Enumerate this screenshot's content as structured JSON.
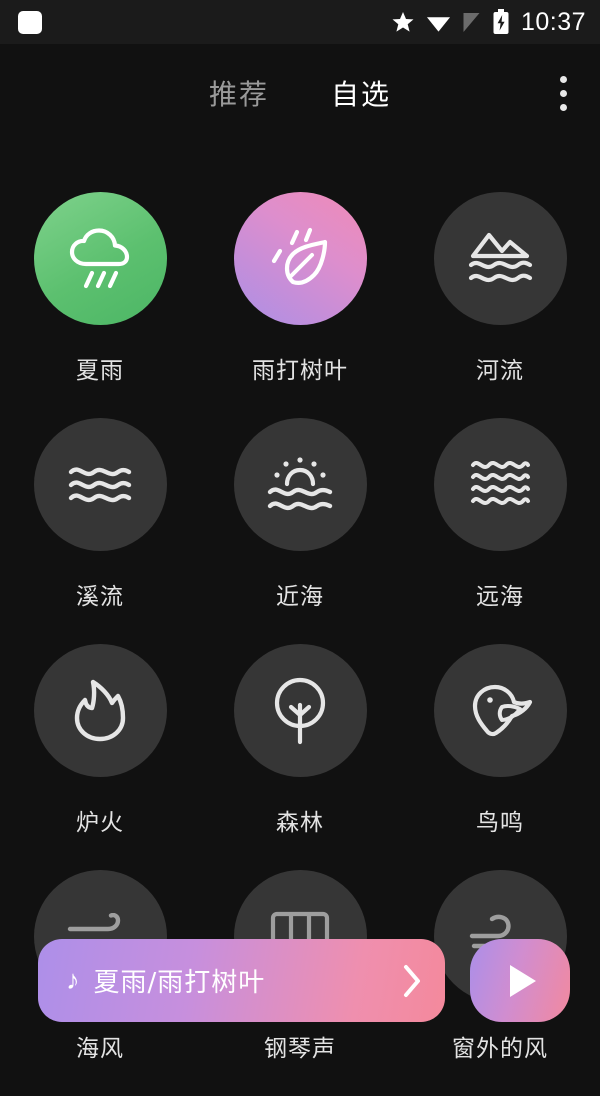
{
  "statusbar": {
    "app_icon": "rounded-square-icon",
    "icons": [
      "star-icon",
      "wifi-icon",
      "signal-icon",
      "battery-charging-icon"
    ],
    "time": "10:37"
  },
  "header": {
    "tabs": [
      {
        "label": "推荐",
        "active": false
      },
      {
        "label": "自选",
        "active": true
      }
    ],
    "overflow_menu": "more-options-icon"
  },
  "grid": {
    "rows": [
      [
        {
          "label": "夏雨",
          "icon": "rain-cloud-icon",
          "style": "grad-green"
        },
        {
          "label": "雨打树叶",
          "icon": "rain-leaf-icon",
          "style": "grad-pink"
        },
        {
          "label": "河流",
          "icon": "mountain-waves-icon",
          "style": "plain"
        }
      ],
      [
        {
          "label": "溪流",
          "icon": "triple-wave-icon",
          "style": "plain"
        },
        {
          "label": "近海",
          "icon": "sun-waves-icon",
          "style": "plain"
        },
        {
          "label": "远海",
          "icon": "dense-waves-icon",
          "style": "plain"
        }
      ],
      [
        {
          "label": "炉火",
          "icon": "flame-icon",
          "style": "plain"
        },
        {
          "label": "森林",
          "icon": "tree-icon",
          "style": "plain"
        },
        {
          "label": "鸟鸣",
          "icon": "bird-icon",
          "style": "plain"
        }
      ],
      [
        {
          "label": "海风",
          "icon": "wind-icon",
          "style": "plain"
        },
        {
          "label": "钢琴声",
          "icon": "piano-keys-icon",
          "style": "plain"
        },
        {
          "label": "窗外的风",
          "icon": "wind-swirl-icon",
          "style": "plain"
        }
      ]
    ]
  },
  "player": {
    "note_icon": "♪",
    "title": "夏雨/雨打树叶",
    "chevron": "chevron-right-icon",
    "play_button": "play-icon"
  },
  "colors": {
    "background": "#111111",
    "statusbar_bg": "#1b1b1b",
    "disc_plain": "#363636",
    "accent_purple": "#ad8fe9",
    "accent_pink": "#f4899c",
    "accent_green": "#5cc06f",
    "text_primary": "#ffffff",
    "text_secondary": "#9a9a9a"
  }
}
